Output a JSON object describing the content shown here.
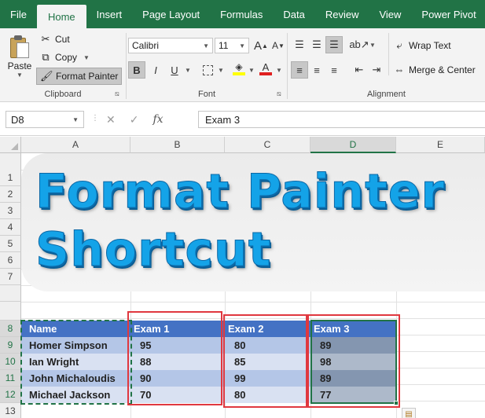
{
  "tabs": [
    "File",
    "Home",
    "Insert",
    "Page Layout",
    "Formulas",
    "Data",
    "Review",
    "View",
    "Power Pivot"
  ],
  "active_tab": "Home",
  "clipboard": {
    "paste_label": "Paste",
    "cut_label": "Cut",
    "copy_label": "Copy",
    "format_painter_label": "Format Painter",
    "group_label": "Clipboard"
  },
  "font": {
    "font_name": "Calibri",
    "font_size": "11",
    "bold": "B",
    "italic": "I",
    "underline": "U",
    "font_color_letter": "A",
    "grow_letter": "A",
    "shrink_letter": "A",
    "group_label": "Font"
  },
  "alignment": {
    "wrap_text_label": "Wrap Text",
    "merge_center_label": "Merge & Center",
    "group_label": "Alignment"
  },
  "formula_bar": {
    "name_box": "D8",
    "fx": "fx",
    "formula": "Exam 3"
  },
  "columns": [
    "A",
    "B",
    "C",
    "D",
    "E"
  ],
  "selected_column": "D",
  "rows": [
    "1",
    "2",
    "3",
    "4",
    "5",
    "6",
    "7",
    "8",
    "9",
    "10",
    "11",
    "12",
    "13"
  ],
  "selected_rows": [
    "8",
    "9",
    "10",
    "11",
    "12"
  ],
  "banner": {
    "line1": "Format Painter",
    "line2": "Shortcut"
  },
  "table": {
    "headers": [
      "Name",
      "Exam 1",
      "Exam 2",
      "Exam 3"
    ],
    "rows": [
      [
        "Homer Simpson",
        "95",
        "80",
        "89"
      ],
      [
        "Ian Wright",
        "88",
        "85",
        "98"
      ],
      [
        "John Michaloudis",
        "90",
        "99",
        "89"
      ],
      [
        "Michael Jackson",
        "70",
        "80",
        "77"
      ]
    ]
  },
  "colors": {
    "excel_green": "#217346",
    "title_blue": "#14a3e8",
    "header_blue": "#4472c4",
    "highlight_red": "#e0383f"
  },
  "icons": {
    "cut": "scissors-icon",
    "copy": "copy-icon",
    "format_painter": "paintbrush-icon",
    "fill": "paint-bucket-icon",
    "wrap": "wrap-text-icon",
    "merge": "merge-center-icon"
  }
}
